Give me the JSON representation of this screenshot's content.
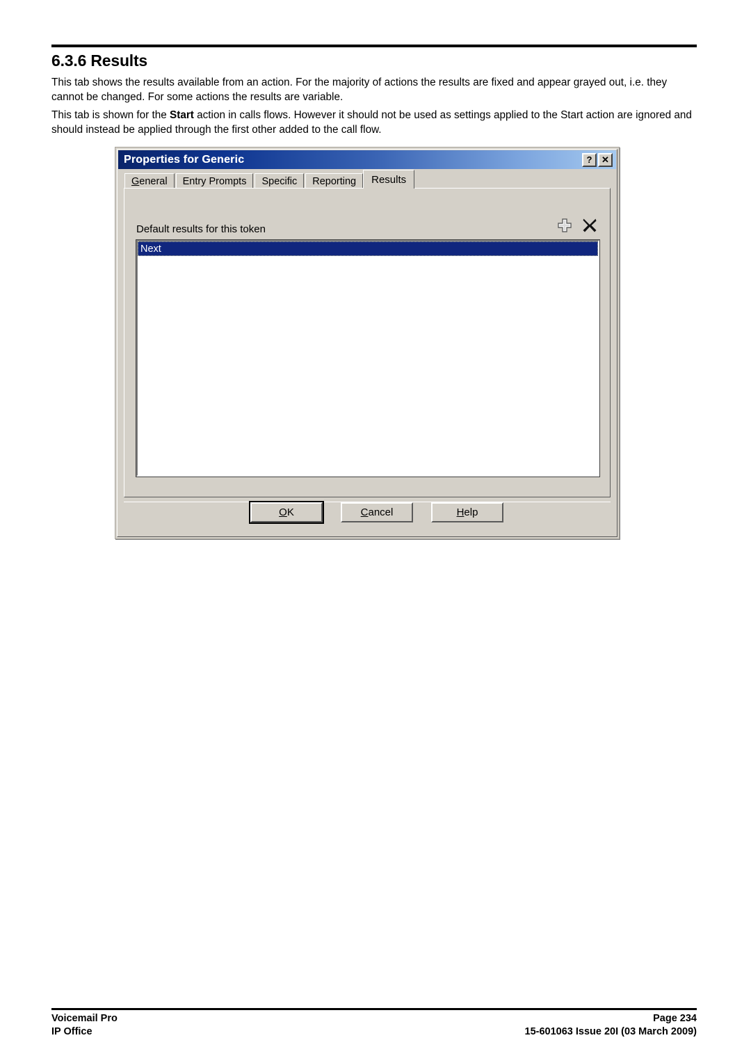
{
  "document": {
    "heading": "6.3.6 Results",
    "paragraphs": [
      "This tab shows the results available from an action. For the majority of actions the results are fixed and appear grayed out, i.e. they cannot be changed. For some actions the results are variable.",
      {
        "before": "This tab is shown for the ",
        "bold": "Start",
        "after": " action in calls flows. However it should not be used as settings applied to the Start action are ignored and should instead be applied through the first other added to the call flow."
      }
    ]
  },
  "dialog": {
    "title": "Properties for Generic",
    "titlebar_buttons": [
      {
        "name": "help-button",
        "glyph": "?"
      },
      {
        "name": "close-button",
        "glyph": "✕"
      }
    ],
    "tabs": [
      {
        "label": "General",
        "accel": "G",
        "active": false
      },
      {
        "label": "Entry Prompts",
        "accel": "",
        "active": false
      },
      {
        "label": "Specific",
        "accel": "",
        "active": false
      },
      {
        "label": "Reporting",
        "accel": "g",
        "active": false
      },
      {
        "label": "Results",
        "accel": "",
        "active": true
      }
    ],
    "field_label": "Default results for this token",
    "toolbar_icons": [
      {
        "name": "add-icon",
        "title": "Add"
      },
      {
        "name": "delete-icon",
        "title": "Delete"
      }
    ],
    "list_items": [
      {
        "label": "Next",
        "selected": true
      }
    ],
    "buttons": [
      {
        "label": "OK",
        "accel": "O",
        "default": true
      },
      {
        "label": "Cancel",
        "accel": "C",
        "default": false
      },
      {
        "label": "Help",
        "accel": "H",
        "default": false
      }
    ]
  },
  "footer": {
    "left_line1": "Voicemail Pro",
    "left_line2": "IP Office",
    "right_line1": "Page 234",
    "right_line2": "15-601063 Issue 20I (03 March 2009)"
  },
  "colors": {
    "dialog_face": "#d4d0c8",
    "title_gradient_start": "#0a246a",
    "title_gradient_end": "#a6caf0",
    "selection": "#10267e"
  }
}
